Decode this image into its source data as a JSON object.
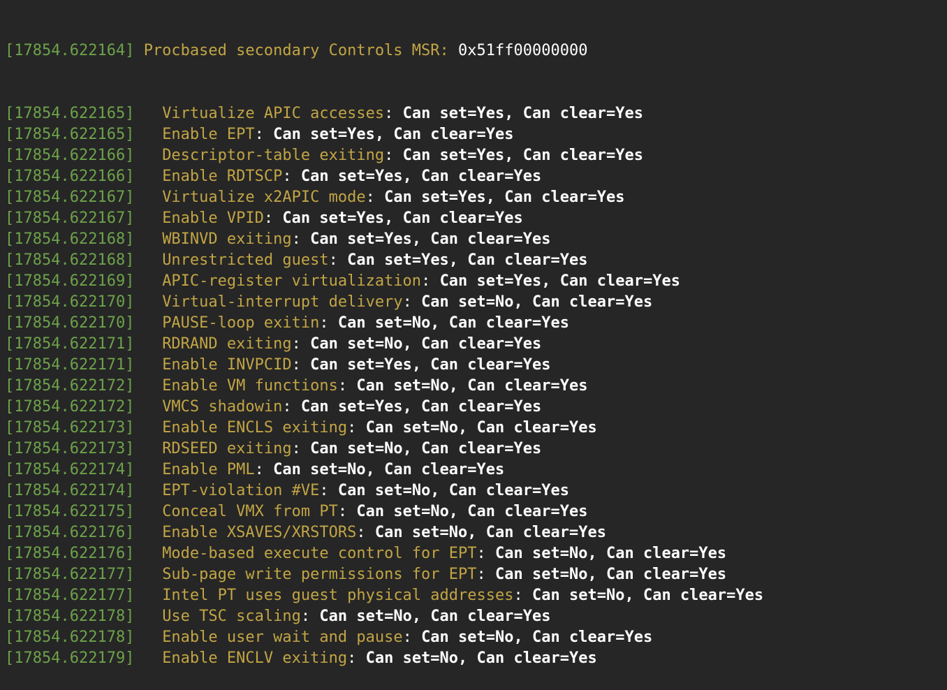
{
  "header": {
    "timestamp": "[17854.622164]",
    "label": "Procbased secondary Controls MSR:",
    "value": "0x51ff00000000"
  },
  "lines": [
    {
      "timestamp": "[17854.622165]",
      "label": "Virtualize APIC accesses",
      "values": "Can set=Yes, Can clear=Yes"
    },
    {
      "timestamp": "[17854.622165]",
      "label": "Enable EPT",
      "values": "Can set=Yes, Can clear=Yes"
    },
    {
      "timestamp": "[17854.622166]",
      "label": "Descriptor-table exiting",
      "values": "Can set=Yes, Can clear=Yes"
    },
    {
      "timestamp": "[17854.622166]",
      "label": "Enable RDTSCP",
      "values": "Can set=Yes, Can clear=Yes"
    },
    {
      "timestamp": "[17854.622167]",
      "label": "Virtualize x2APIC mode",
      "values": "Can set=Yes, Can clear=Yes"
    },
    {
      "timestamp": "[17854.622167]",
      "label": "Enable VPID",
      "values": "Can set=Yes, Can clear=Yes"
    },
    {
      "timestamp": "[17854.622168]",
      "label": "WBINVD exiting",
      "values": "Can set=Yes, Can clear=Yes"
    },
    {
      "timestamp": "[17854.622168]",
      "label": "Unrestricted guest",
      "values": "Can set=Yes, Can clear=Yes"
    },
    {
      "timestamp": "[17854.622169]",
      "label": "APIC-register virtualization",
      "values": "Can set=Yes, Can clear=Yes"
    },
    {
      "timestamp": "[17854.622170]",
      "label": "Virtual-interrupt delivery",
      "values": "Can set=No, Can clear=Yes"
    },
    {
      "timestamp": "[17854.622170]",
      "label": "PAUSE-loop exitin",
      "values": "Can set=No, Can clear=Yes"
    },
    {
      "timestamp": "[17854.622171]",
      "label": "RDRAND exiting",
      "values": "Can set=No, Can clear=Yes"
    },
    {
      "timestamp": "[17854.622171]",
      "label": "Enable INVPCID",
      "values": "Can set=Yes, Can clear=Yes"
    },
    {
      "timestamp": "[17854.622172]",
      "label": "Enable VM functions",
      "values": "Can set=No, Can clear=Yes"
    },
    {
      "timestamp": "[17854.622172]",
      "label": "VMCS shadowin",
      "values": "Can set=Yes, Can clear=Yes"
    },
    {
      "timestamp": "[17854.622173]",
      "label": "Enable ENCLS exiting",
      "values": "Can set=No, Can clear=Yes"
    },
    {
      "timestamp": "[17854.622173]",
      "label": "RDSEED exiting",
      "values": "Can set=No, Can clear=Yes"
    },
    {
      "timestamp": "[17854.622174]",
      "label": "Enable PML",
      "values": "Can set=No, Can clear=Yes"
    },
    {
      "timestamp": "[17854.622174]",
      "label": "EPT-violation #VE",
      "values": "Can set=No, Can clear=Yes"
    },
    {
      "timestamp": "[17854.622175]",
      "label": "Conceal VMX from PT",
      "values": "Can set=No, Can clear=Yes"
    },
    {
      "timestamp": "[17854.622176]",
      "label": "Enable XSAVES/XRSTORS",
      "values": "Can set=No, Can clear=Yes"
    },
    {
      "timestamp": "[17854.622176]",
      "label": "Mode-based execute control for EPT",
      "values": "Can set=No, Can clear=Yes"
    },
    {
      "timestamp": "[17854.622177]",
      "label": "Sub-page write permissions for EPT",
      "values": "Can set=No, Can clear=Yes"
    },
    {
      "timestamp": "[17854.622177]",
      "label": "Intel PT uses guest physical addresses",
      "values": "Can set=No, Can clear=Yes"
    },
    {
      "timestamp": "[17854.622178]",
      "label": "Use TSC scaling",
      "values": "Can set=No, Can clear=Yes"
    },
    {
      "timestamp": "[17854.622178]",
      "label": "Enable user wait and pause",
      "values": "Can set=No, Can clear=Yes"
    },
    {
      "timestamp": "[17854.622179]",
      "label": "Enable ENCLV exiting",
      "values": "Can set=No, Can clear=Yes"
    }
  ],
  "colors": {
    "background": "#262626",
    "timestamp": "#6da24a",
    "label": "#c2a545",
    "values": "#ffffff"
  }
}
